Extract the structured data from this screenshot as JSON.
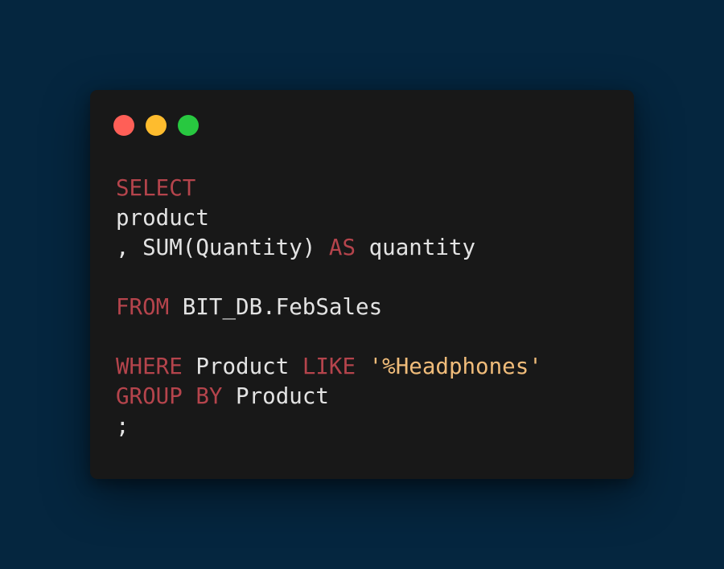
{
  "colors": {
    "page_background": "#05263F",
    "window_background": "#181818",
    "keyword": "#B5444C",
    "text": "#E3E3E3",
    "string": "#F0BC7A"
  },
  "window_controls": [
    {
      "name": "close",
      "color": "#FF5F57"
    },
    {
      "name": "minimize",
      "color": "#FEBC2E"
    },
    {
      "name": "maximize",
      "color": "#28C840"
    }
  ],
  "code": {
    "line1": {
      "kw": "SELECT"
    },
    "line2": {
      "text": "product"
    },
    "line3": {
      "text": ", SUM(Quantity) ",
      "kw": "AS",
      "text2": " quantity"
    },
    "line5": {
      "kw": "FROM",
      "text": " BIT_DB.FebSales"
    },
    "line7": {
      "kw1": "WHERE",
      "text1": " Product ",
      "kw2": "LIKE",
      "text2": " ",
      "str": "'%Headphones'"
    },
    "line8": {
      "kw1": "GROUP",
      "text1": " ",
      "kw2": "BY",
      "text2": " Product"
    },
    "line9": {
      "text": ";"
    }
  }
}
